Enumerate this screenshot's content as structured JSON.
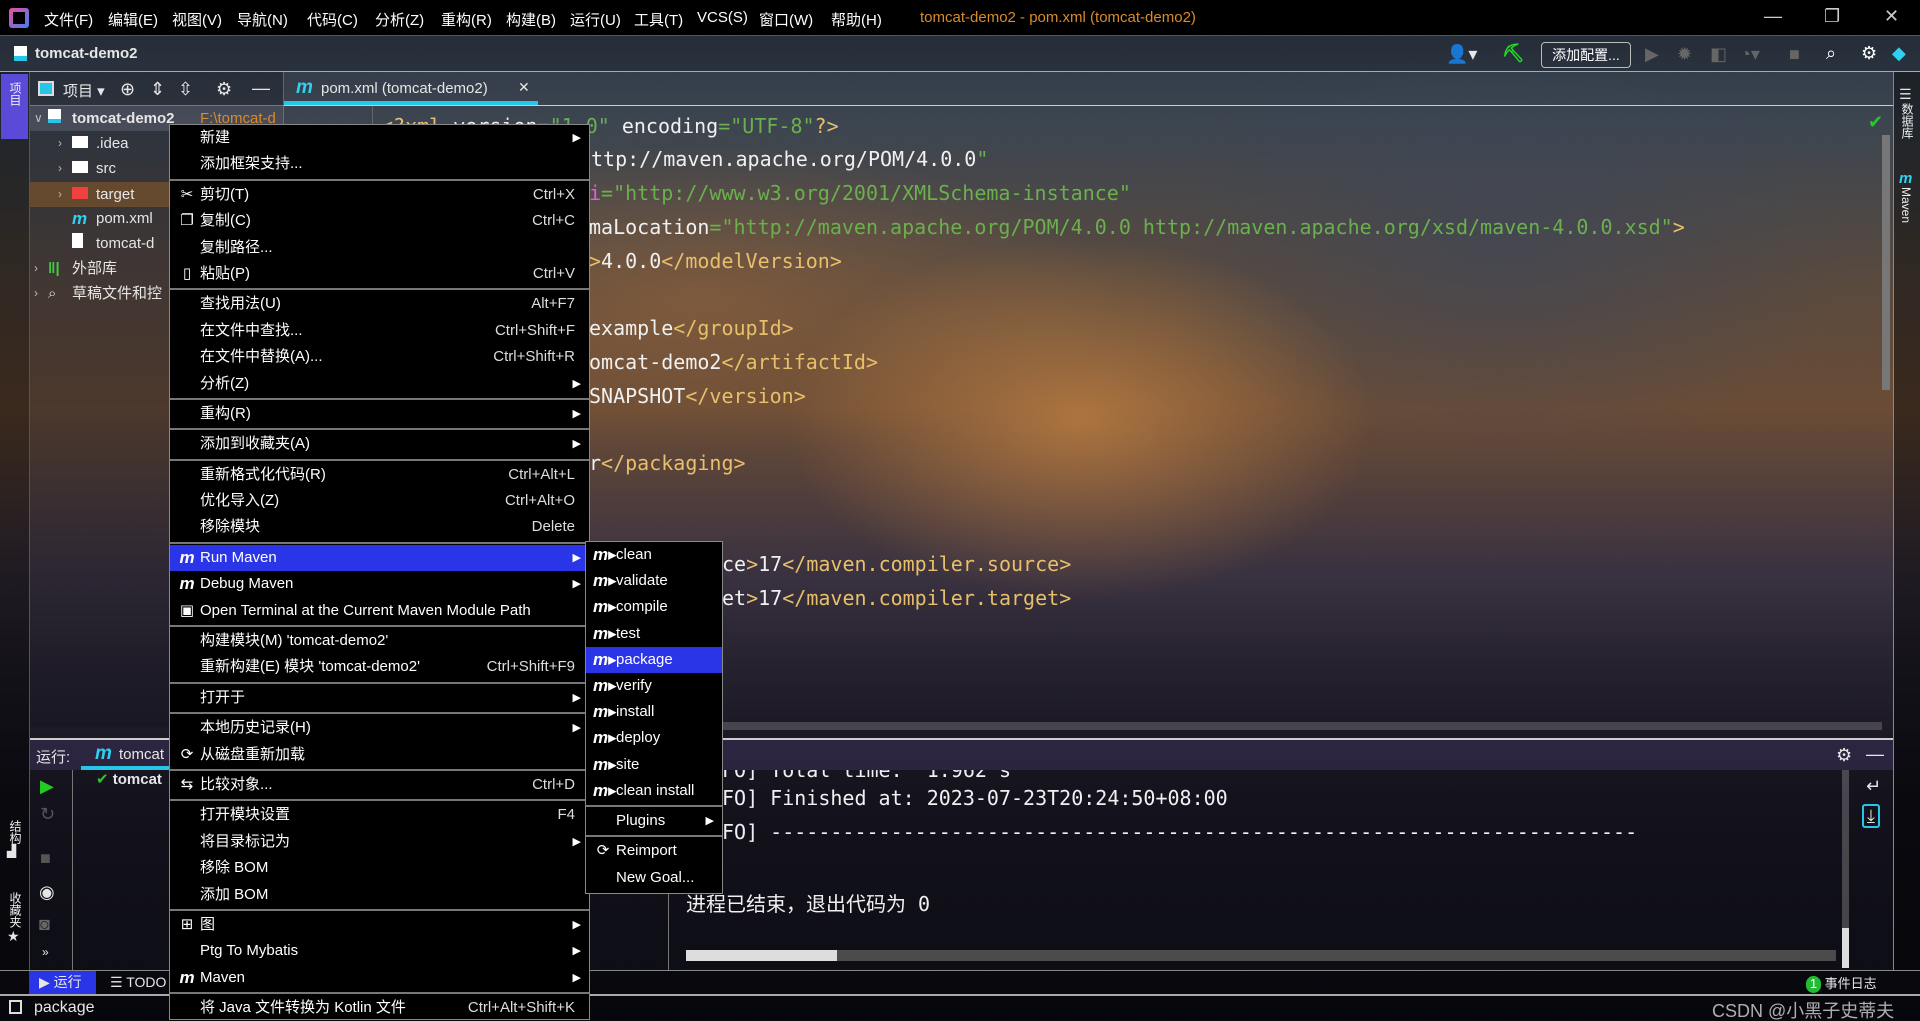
{
  "titlebar": {
    "menu": [
      "文件(F)",
      "编辑(E)",
      "视图(V)",
      "导航(N)",
      "代码(C)",
      "分析(Z)",
      "重构(R)",
      "构建(B)",
      "运行(U)",
      "工具(T)",
      "VCS(S)",
      "窗口(W)",
      "帮助(H)"
    ],
    "window_title": "tomcat-demo2 - pom.xml (tomcat-demo2)",
    "title_color": "#d98a2b"
  },
  "navbar": {
    "project": "tomcat-demo2",
    "add_config": "添加配置..."
  },
  "left_stripe": {
    "project": "项目",
    "structure": "结构",
    "favorites": "收藏夹"
  },
  "right_stripe": {
    "database": "数据库",
    "maven": "Maven"
  },
  "project_panel": {
    "view": "项目",
    "tree": [
      {
        "label": "tomcat-demo2",
        "extra": "F:\\tomcat-d",
        "icon": "module-folder-icon"
      },
      {
        "label": ".idea",
        "icon": "folder-icon"
      },
      {
        "label": "src",
        "icon": "folder-icon"
      },
      {
        "label": "target",
        "icon": "excluded-folder-icon"
      },
      {
        "label": "pom.xml",
        "icon": "maven-icon"
      },
      {
        "label": "tomcat-d",
        "icon": "file-icon"
      },
      {
        "label": "外部库",
        "icon": "library-icon"
      },
      {
        "label": "草稿文件和控",
        "icon": "scratch-icon"
      }
    ]
  },
  "editor": {
    "tab": "pom.xml (tomcat-demo2)",
    "lines": [
      "<?xml version=\"1.0\" encoding=\"UTF-8\"?>",
      "ttp://maven.apache.org/POM/4.0.0\"",
      "i=\"http://www.w3.org/2001/XMLSchema-instance\"",
      "maLocation=\"http://maven.apache.org/POM/4.0.0 http://maven.apache.org/xsd/maven-4.0.0.xsd\">",
      ">4.0.0</modelVersion>",
      "example</groupId>",
      "omcat-demo2</artifactId>",
      "SNAPSHOT</version>",
      "r</packaging>",
      "ce>17</maven.compiler.source>",
      "et>17</maven.compiler.target>"
    ]
  },
  "context_menu": {
    "groups": [
      [
        {
          "label": "新建",
          "arrow": true
        },
        {
          "label": "添加框架支持..."
        }
      ],
      [
        {
          "label": "剪切(T)",
          "shortcut": "Ctrl+X",
          "icon": "✂",
          "name": "cut"
        },
        {
          "label": "复制(C)",
          "shortcut": "Ctrl+C",
          "icon": "❐",
          "name": "copy"
        },
        {
          "label": "复制路径..."
        },
        {
          "label": "粘贴(P)",
          "shortcut": "Ctrl+V",
          "icon": "▯",
          "name": "paste"
        }
      ],
      [
        {
          "label": "查找用法(U)",
          "shortcut": "Alt+F7"
        },
        {
          "label": "在文件中查找...",
          "shortcut": "Ctrl+Shift+F"
        },
        {
          "label": "在文件中替换(A)...",
          "shortcut": "Ctrl+Shift+R"
        },
        {
          "label": "分析(Z)",
          "arrow": true
        }
      ],
      [
        {
          "label": "重构(R)",
          "arrow": true
        }
      ],
      [
        {
          "label": "添加到收藏夹(A)",
          "arrow": true
        }
      ],
      [
        {
          "label": "重新格式化代码(R)",
          "shortcut": "Ctrl+Alt+L"
        },
        {
          "label": "优化导入(Z)",
          "shortcut": "Ctrl+Alt+O"
        },
        {
          "label": "移除模块",
          "shortcut": "Delete"
        }
      ],
      [
        {
          "label": "Run Maven",
          "arrow": true,
          "icon": "m",
          "name": "maven-run",
          "highlight": true
        },
        {
          "label": "Debug Maven",
          "arrow": true,
          "icon": "m",
          "name": "maven-debug"
        },
        {
          "label": "Open Terminal at the Current Maven Module Path",
          "icon": "▣",
          "name": "terminal"
        }
      ],
      [
        {
          "label": "构建模块(M) 'tomcat-demo2'"
        },
        {
          "label": "重新构建(E) 模块 'tomcat-demo2'",
          "shortcut": "Ctrl+Shift+F9"
        }
      ],
      [
        {
          "label": "打开于",
          "arrow": true
        }
      ],
      [
        {
          "label": "本地历史记录(H)",
          "arrow": true
        },
        {
          "label": "从磁盘重新加载",
          "icon": "⟳",
          "name": "reload"
        }
      ],
      [
        {
          "label": "比较对象...",
          "shortcut": "Ctrl+D",
          "icon": "⇆",
          "name": "compare"
        }
      ],
      [
        {
          "label": "打开模块设置",
          "shortcut": "F4"
        },
        {
          "label": "将目录标记为",
          "arrow": true
        },
        {
          "label": "移除 BOM"
        },
        {
          "label": "添加 BOM"
        }
      ],
      [
        {
          "label": "图",
          "arrow": true,
          "icon": "⊞",
          "name": "diagram"
        },
        {
          "label": "Ptg To Mybatis",
          "arrow": true
        },
        {
          "label": "Maven",
          "arrow": true,
          "icon": "m",
          "name": "maven"
        }
      ],
      [
        {
          "label": "将 Java 文件转换为 Kotlin 文件",
          "shortcut": "Ctrl+Alt+Shift+K"
        }
      ]
    ]
  },
  "run_maven_submenu": {
    "goals": [
      "clean",
      "validate",
      "compile",
      "test",
      "package",
      "verify",
      "install",
      "deploy",
      "site",
      "clean install"
    ],
    "selected": "package",
    "plugins": "Plugins",
    "reimport": "Reimport",
    "new_goal": "New Goal..."
  },
  "run_panel": {
    "label": "运行:",
    "tab": "tomcat",
    "tree_item": "tomcat",
    "console": [
      "FO] Total time:  1.962 s",
      "FO] Finished at: 2023-07-23T20:24:50+08:00",
      "FO] ------------------------------------------------------------------------",
      "进程已结束，退出代码为 0"
    ]
  },
  "bottom_bar": {
    "run": "运行",
    "todo": "TODO",
    "event_count": "1",
    "event_log": "事件日志"
  },
  "status_bar": {
    "text": "package",
    "watermark": "CSDN @小黑子史蒂夫"
  },
  "colors": {
    "accent": "#2b35e8",
    "tab_underline": "#27c6e8",
    "success": "#22cc22",
    "maven": "#2fd0f0"
  }
}
